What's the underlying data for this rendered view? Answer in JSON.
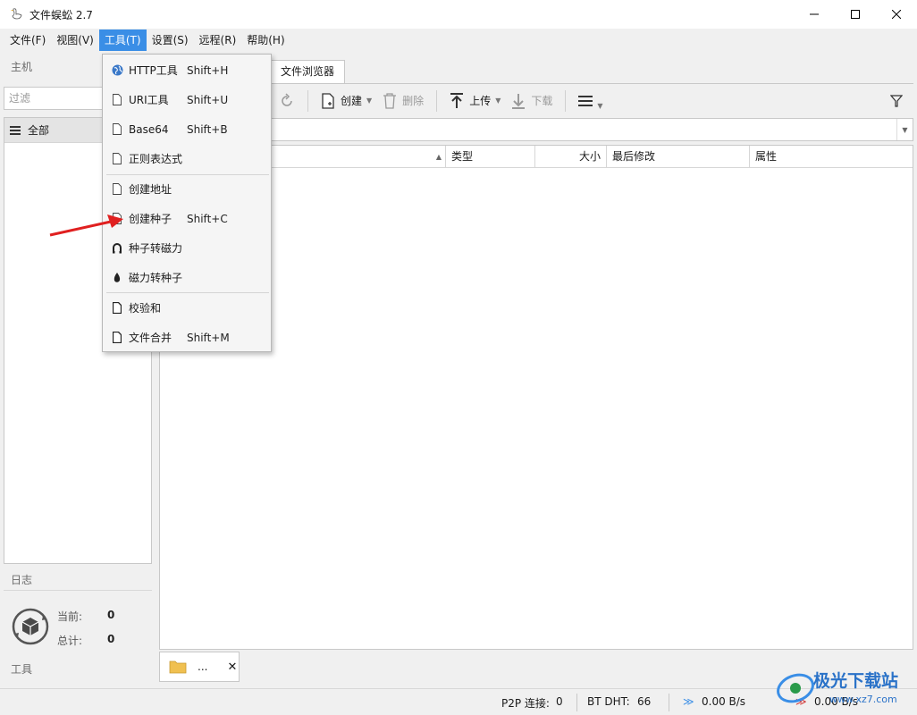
{
  "window": {
    "title": "文件蜈蚣 2.7"
  },
  "menu": {
    "items": [
      "文件(F)",
      "视图(V)",
      "工具(T)",
      "设置(S)",
      "远程(R)",
      "帮助(H)"
    ]
  },
  "left": {
    "host_label": "主机",
    "filter_placeholder": "过滤",
    "all_label": "全部",
    "log_label": "日志",
    "current_label": "当前:",
    "current_value": "0",
    "total_label": "总计:",
    "total_value": "0",
    "tools_label": "工具"
  },
  "tab": {
    "label": "文件浏览器"
  },
  "toolbar": {
    "create": "创建",
    "delete": "删除",
    "upload": "上传",
    "download": "下载"
  },
  "columns": {
    "type": "类型",
    "size": "大小",
    "modified": "最后修改",
    "attrs": "属性"
  },
  "bottom_tab": {
    "label": "..."
  },
  "status": {
    "p2p_label": "P2P 连接:",
    "p2p_value": "0",
    "dht_label": "BT DHT:",
    "dht_value": "66",
    "down_speed": "0.00 B/s",
    "up_speed": "0.00 B/s"
  },
  "tools_menu": {
    "items": [
      {
        "label": "HTTP工具",
        "shortcut": "Shift+H",
        "icon": "globe-icon"
      },
      {
        "label": "URI工具",
        "shortcut": "Shift+U",
        "icon": "document-icon"
      },
      {
        "label": "Base64",
        "shortcut": "Shift+B",
        "icon": "document-icon"
      },
      {
        "label": "正则表达式",
        "shortcut": "",
        "icon": "document-icon"
      },
      {
        "label": "创建地址",
        "shortcut": "",
        "icon": "document-icon"
      },
      {
        "label": "创建种子",
        "shortcut": "Shift+C",
        "icon": "document-icon"
      },
      {
        "label": "种子转磁力",
        "shortcut": "",
        "icon": "magnet-icon"
      },
      {
        "label": "磁力转种子",
        "shortcut": "",
        "icon": "seed-icon"
      },
      {
        "label": "校验和",
        "shortcut": "",
        "icon": "document-icon"
      },
      {
        "label": "文件合并",
        "shortcut": "Shift+M",
        "icon": "document-icon"
      }
    ]
  },
  "watermark": {
    "text": "极光下载站",
    "url": "www.xz7.com"
  },
  "colors": {
    "accent": "#3a8ee6",
    "arrow": "#e02020"
  }
}
